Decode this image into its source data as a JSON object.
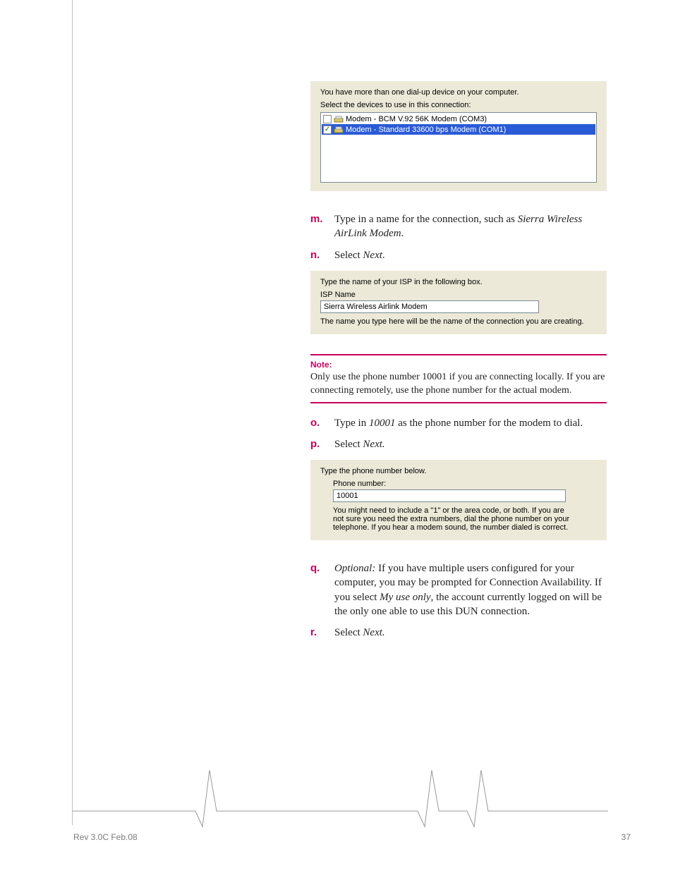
{
  "panel1": {
    "line1": "You have more than one dial-up device on your computer.",
    "line2": "Select the devices to use in this connection:",
    "items": [
      {
        "checked": false,
        "label": "Modem - BCM V.92 56K Modem (COM3)"
      },
      {
        "checked": true,
        "label": "Modem - Standard 33600 bps Modem (COM1)"
      }
    ]
  },
  "steps_a": [
    {
      "bullet": "m.",
      "prefix": "Type in a name for the connection, such as ",
      "italic": "Sierra Wireless AirLink Modem",
      "suffix": "."
    },
    {
      "bullet": "n.",
      "prefix": "Select ",
      "italic": "Next",
      "suffix": "."
    }
  ],
  "panel2": {
    "prompt": "Type the name of your ISP in the following box.",
    "label": "ISP Name",
    "value": "Sierra Wireless Airlink Modem",
    "hint": "The name you type here will be the name of the connection you are creating."
  },
  "note": {
    "heading": "Note:",
    "body": "Only use the phone number 10001 if you are connecting locally. If you are connecting remotely, use the phone number for the actual modem."
  },
  "steps_b": [
    {
      "bullet": "o.",
      "prefix": "Type in ",
      "italic": "10001",
      "suffix": " as the phone number for the modem to dial."
    },
    {
      "bullet": "p.",
      "prefix": "Select ",
      "italic": "Next.",
      "suffix": ""
    }
  ],
  "panel3": {
    "prompt": "Type the phone number below.",
    "label": "Phone number:",
    "value": "10001",
    "hint": "You might need to include a \"1\" or the area code, or both. If you are not sure you need the extra numbers, dial the phone number on your telephone. If you hear a modem sound, the number dialed is correct."
  },
  "steps_c": [
    {
      "bullet": "q.",
      "prefix_italic": "Optional:",
      "prefix_after": " If you have multiple users configured for your computer, you may be prompted for Connection Availability. If you select ",
      "italic": "My use only",
      "suffix": ", the account currently logged on will be the only one able to use this DUN connection."
    },
    {
      "bullet": "r.",
      "prefix": "Select ",
      "italic": "Next.",
      "suffix": ""
    }
  ],
  "footer": {
    "left": "Rev 3.0C Feb.08",
    "right": "37"
  }
}
